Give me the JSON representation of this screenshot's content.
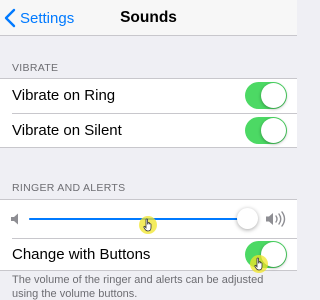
{
  "nav": {
    "back_label": "Settings",
    "title": "Sounds"
  },
  "vibrate": {
    "header": "VIBRATE",
    "items": [
      {
        "label": "Vibrate on Ring",
        "on": true
      },
      {
        "label": "Vibrate on Silent",
        "on": true
      }
    ]
  },
  "ringer": {
    "header": "RINGER AND ALERTS",
    "volume_level": 0.97,
    "change_with_buttons": {
      "label": "Change with Buttons",
      "on": true
    },
    "footer": "The volume of the ringer and alerts can be adjusted using the volume buttons."
  },
  "colors": {
    "accent": "#007aff",
    "toggle_on": "#4cd964",
    "background": "#efeff4",
    "highlight": "#f0e628"
  },
  "icons": {
    "back": "chevron-left-icon",
    "volume_low": "speaker-low-icon",
    "volume_high": "speaker-high-icon",
    "pointer": "hand-pointer-icon"
  }
}
